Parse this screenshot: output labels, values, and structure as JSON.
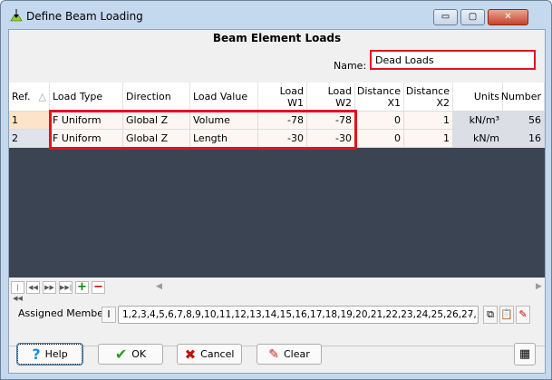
{
  "window": {
    "title": "Define Beam Loading",
    "minimize": "▭",
    "maximize": "▢",
    "close": "✕"
  },
  "heading": "Beam Element Loads",
  "name": {
    "label": "Name:",
    "value": "Dead Loads"
  },
  "columns": [
    "Ref.",
    "Load Type",
    "Direction",
    "Load Value",
    "Load W1",
    "Load W2",
    "Distance X1",
    "Distance X2",
    "Units",
    "Number"
  ],
  "rows": [
    [
      "1",
      "F Uniform",
      "Global Z",
      "Volume",
      "-78",
      "-78",
      "0",
      "1",
      "kN/m³",
      "56"
    ],
    [
      "2",
      "F Uniform",
      "Global Z",
      "Length",
      "-30",
      "-30",
      "0",
      "1",
      "kN/m",
      "16"
    ]
  ],
  "assigned": {
    "label": "Assigned Members:",
    "value": "1,2,3,4,5,6,7,8,9,10,11,12,13,14,15,16,17,18,19,20,21,22,23,24,25,26,27,"
  },
  "buttons": {
    "help": "Help",
    "ok": "OK",
    "cancel": "Cancel",
    "clear": "Clear"
  }
}
